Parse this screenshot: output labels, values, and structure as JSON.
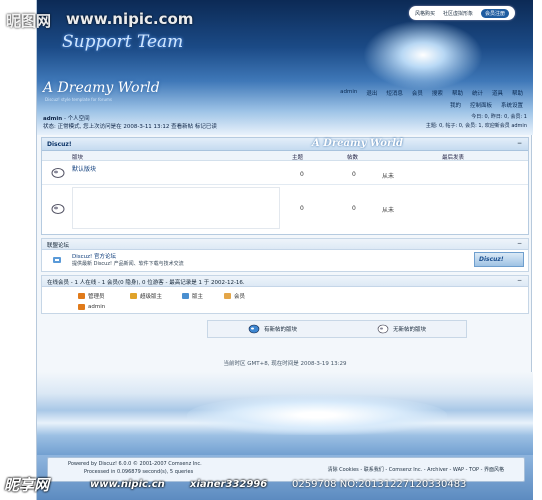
{
  "watermark": {
    "top_cn": "昵图网",
    "top_url": "www.nipic.com",
    "bottom_cn": "昵享网",
    "bottom_url": "www.nipic.cn",
    "bottom_author": "xianer332996",
    "bottom_number": "0259708 NO:20131227120330483"
  },
  "header": {
    "support_title": "Support Team",
    "brand_title": "A Dreamy World",
    "brand_subtitle": "Discuz! style template for forums",
    "top_tabs": [
      "风格购买",
      "社区虚拟形象",
      "会员注册"
    ],
    "nav": [
      "admin",
      "退出",
      "短消息",
      "会员",
      "搜索",
      "帮助",
      "统计",
      "道具",
      "帮助"
    ],
    "nav2": [
      "我的",
      "控制面板",
      "系统设置"
    ],
    "user": "admin",
    "user_space": "个人空间",
    "status": "状态: 正常模式, 您上次访问是在 2008-3-11 13:12   查看新帖 标记已读",
    "right_line1": "今日: 0, 昨日: 0, 会员: 1",
    "right_line2": "主题: 0, 帖子: 0, 会员: 1, 欢迎新会员 admin"
  },
  "forum": {
    "title": "Discuz!",
    "banner": "A Dreamy World",
    "collapse": "−",
    "columns": {
      "forum": "版块",
      "topics": "主题",
      "posts": "帖数",
      "last": "最后发表"
    },
    "rows": [
      {
        "name": "默认版块",
        "topics": "0",
        "posts": "0",
        "last": "从未"
      },
      {
        "name": "",
        "topics": "0",
        "posts": "0",
        "last": "从未"
      }
    ]
  },
  "links": {
    "title": "联盟论坛",
    "collapse": "−",
    "name": "Discuz! 官方论坛",
    "desc": "提供最新 Discuz! 产品新闻、软件下载与技术交流",
    "logo_text": "Discuz!"
  },
  "online": {
    "title": "在线会员 - 1 人在线 - 1 会员(0 隐身), 0 位游客 - 最高记录是 1 于 2002-12-16.",
    "collapse": "−",
    "legend": [
      {
        "label": "管理员",
        "color": "#e07a1a"
      },
      {
        "label": "超级版主",
        "color": "#e0a32a"
      },
      {
        "label": "版主",
        "color": "#4a8fd0"
      },
      {
        "label": "会员",
        "color": "#e4a648"
      }
    ],
    "member": "admin"
  },
  "bottom_links": {
    "new": "有新帖的版块",
    "none": "无新帖的版块"
  },
  "time_line": "当前时区 GMT+8, 现在时间是 2008-3-19 13:29",
  "footer": {
    "powered": "Powered by Discuz! 6.0.0 © 2001-2007 Comsenz Inc.",
    "processed": "Processed in 0.096879 second(s), 5 queries",
    "links": "清除 Cookies - 联系我们 - Comsenz Inc. - Archiver - WAP - TOP - 界面风格"
  }
}
